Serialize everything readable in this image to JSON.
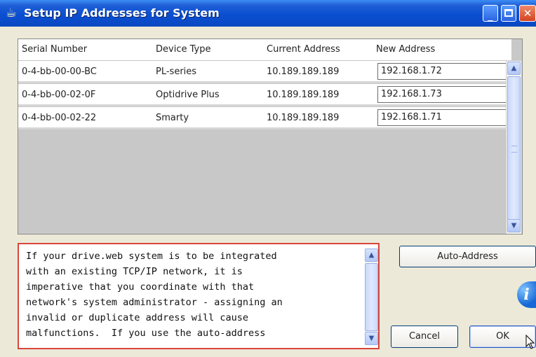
{
  "window": {
    "title": "Setup IP Addresses for System",
    "icon": "java-cup-icon",
    "controls": {
      "minimize": "minimize-icon",
      "maximize": "maximize-icon",
      "close": "close-icon"
    }
  },
  "table": {
    "columns": [
      "Serial Number",
      "Device Type",
      "Current Address",
      "New Address"
    ],
    "rows": [
      {
        "serial": "0-4-bb-00-00-BC",
        "device_type": "PL-series",
        "current_address": "10.189.189.189",
        "new_address": "192.168.1.72"
      },
      {
        "serial": "0-4-bb-00-02-0F",
        "device_type": "Optidrive Plus",
        "current_address": "10.189.189.189",
        "new_address": "192.168.1.73"
      },
      {
        "serial": "0-4-bb-00-02-22",
        "device_type": "Smarty",
        "current_address": "10.189.189.189",
        "new_address": "192.168.1.71"
      }
    ]
  },
  "notice": {
    "lines": [
      "If your drive.web system is to be integrated",
      "with an existing TCP/IP network, it is",
      "imperative that you coordinate with that",
      "network's system administrator - assigning an",
      "invalid or duplicate address will cause",
      "malfunctions.  If you use the auto-address"
    ]
  },
  "buttons": {
    "auto_address": "Auto-Address",
    "cancel": "Cancel",
    "ok": "OK",
    "info_glyph": "i"
  },
  "colors": {
    "titlebar": "#0a4fd1",
    "notice_border": "#d9453b",
    "table_empty_area": "#c8c8c8"
  }
}
